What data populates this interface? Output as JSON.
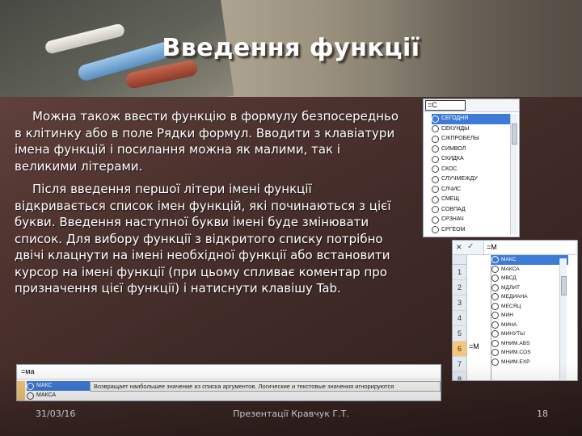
{
  "slide": {
    "title": "Введення функції",
    "paragraphs": [
      "Можна також ввести функцію в формулу безпосередньо в клітинку або в поле Рядки формул. Вводити з клавіатури імена функцій і посилання можна як малими, так і великими літерами.",
      "Після введення першої літери імені функції відкривається список імен функцій, які починаються з цієї букви. Введення наступної букви імені буде змінювати список. Для вибору функції з відкритого списку потрібно двічі клацнути на імені необхідної функції або встановити курсор на імені функції (при цьому спливає коментар про призначення цієї функції) і натиснути клавішу Tab."
    ],
    "footer": {
      "date": "31/03/16",
      "center": "Презентації Кравчук Г.Т.",
      "page": "18"
    }
  },
  "excel_popup_1": {
    "input_value": "=С",
    "functions": [
      "СЕГОДНЯ",
      "СЕКУНДЫ",
      "СЖПРОБЕЛЫ",
      "СИМВОЛ",
      "СКИДКА",
      "СКОС",
      "СЛУЧМЕЖДУ",
      "СЛЧИС",
      "СМЕЩ",
      "СОВПАД",
      "СРЗНАЧ",
      "СРГЕОМ"
    ],
    "selected_index": 0
  },
  "excel_popup_2": {
    "formula_value": "=М",
    "icons": {
      "cancel": "✕",
      "confirm": "✓",
      "fx": "fx"
    },
    "row_headers": [
      "1",
      "2",
      "3",
      "4",
      "5",
      "6",
      "7",
      "8"
    ],
    "active_row": "6",
    "cell_value": "=М",
    "functions": [
      "МАКС",
      "МАКСА",
      "МВСД",
      "МДЛИТ",
      "МЕДИАНА",
      "МЕСЯЦ",
      "МИН",
      "МИНА",
      "МИНУТЫ",
      "МНИМ.ABS",
      "МНИМ.COS",
      "МНИМ.EXP"
    ],
    "selected_index": 0
  },
  "excel_popup_3": {
    "input_value": "=ма",
    "functions": [
      "МАКС",
      "МАКСА"
    ],
    "selected_index": 0,
    "tooltip": "Возвращает наибольшее значение из списка аргументов. Логические и текстовые значения игнорируются"
  },
  "colors": {
    "title_text": "#ffffff",
    "selection_blue": "#3e7bd6",
    "active_row_orange": "#f5c57a"
  }
}
